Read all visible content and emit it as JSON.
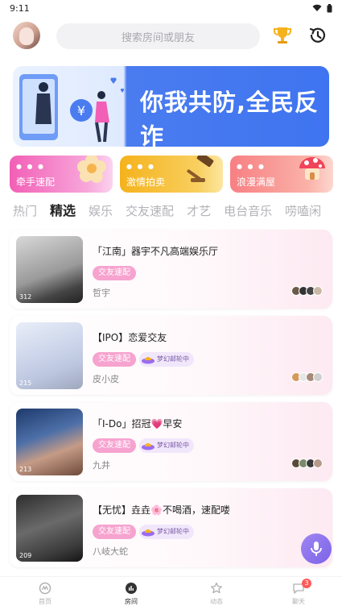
{
  "status_bar": {
    "time": "9:11"
  },
  "header": {
    "search_placeholder": "搜索房间或朋友"
  },
  "banner": {
    "text": "你我共防,全民反诈"
  },
  "categories": [
    {
      "label": "牵手速配"
    },
    {
      "label": "激情拍卖"
    },
    {
      "label": "浪漫满屋"
    }
  ],
  "tabs": [
    {
      "label": "热门"
    },
    {
      "label": "精选",
      "active": true
    },
    {
      "label": "娱乐"
    },
    {
      "label": "交友速配"
    },
    {
      "label": "才艺"
    },
    {
      "label": "电台音乐"
    },
    {
      "label": "唠嗑闲"
    }
  ],
  "rooms": [
    {
      "title": "「江南」器宇不凡高端娱乐厅",
      "tag": "交友速配",
      "secondary_tag": "",
      "owner": "哲宇",
      "count": "312"
    },
    {
      "title": "【IPO】恋爱交友",
      "tag": "交友速配",
      "secondary_tag": "梦幻邮轮中",
      "owner": "皮小皮",
      "count": "215"
    },
    {
      "title": "「I-Do」招冠💗早安",
      "tag": "交友速配",
      "secondary_tag": "梦幻邮轮中",
      "owner": "九井",
      "count": "213"
    },
    {
      "title": "【无忧】垚垚🌸不喝酒，速配喽",
      "tag": "交友速配",
      "secondary_tag": "梦幻邮轮中",
      "owner": "八岐大蛇",
      "count": "209"
    }
  ],
  "bottom_nav": [
    {
      "label": "首页"
    },
    {
      "label": "房间",
      "active": true
    },
    {
      "label": "动态"
    },
    {
      "label": "聊天",
      "badge": "3"
    }
  ],
  "colors": {
    "accent_blue": "#3f74f0",
    "tag_pink": "#f6a3cf",
    "fab_purple": "#7c63e8"
  }
}
